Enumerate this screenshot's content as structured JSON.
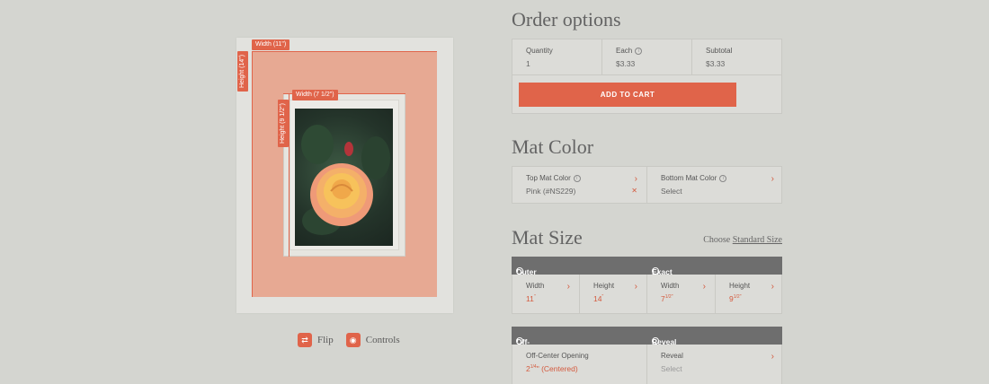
{
  "preview": {
    "outer_width_tag": "Width (11\")",
    "outer_height_tag": "Height (14\")",
    "inner_width_tag": "Width (7 1/2\")",
    "inner_height_tag": "Height (9 1/2\")",
    "photo_icon": "rose-photo",
    "flip_label": "Flip",
    "controls_label": "Controls"
  },
  "order": {
    "title": "Order options",
    "quantity_label": "Quantity",
    "quantity_value": "1",
    "each_label": "Each",
    "each_value": "$3.33",
    "subtotal_label": "Subtotal",
    "subtotal_value": "$3.33",
    "add_to_cart": "ADD TO CART"
  },
  "mat_color": {
    "title": "Mat Color",
    "top_label": "Top Mat Color",
    "top_value": "Pink (#NS229)",
    "bottom_label": "Bottom Mat Color",
    "bottom_value": "Select"
  },
  "mat_size": {
    "title": "Mat Size",
    "choose_label": "Choose",
    "choose_link": "Standard Size",
    "outer_header": "Outer size",
    "opening_header": "Exact Opening Size",
    "outer_width_label": "Width",
    "outer_width_value": "11",
    "outer_height_label": "Height",
    "outer_height_value": "14",
    "opening_width_label": "Width",
    "opening_width_whole": "7",
    "opening_width_frac": "1/2",
    "opening_height_label": "Height",
    "opening_height_whole": "9",
    "opening_height_frac": "1/2",
    "inch_mark": "\""
  },
  "offcenter": {
    "offcenter_header": "Off-Center Opening",
    "reveal_header": "Reveal",
    "offcenter_label": "Off-Center Opening",
    "offcenter_whole": "2",
    "offcenter_frac": "1/4",
    "offcenter_suffix": "\" (Centered)",
    "reveal_label": "Reveal",
    "reveal_value": "Select"
  },
  "colors": {
    "accent": "#e0644a",
    "background": "#d4d5d0",
    "dark_bar": "#6e6e6e"
  }
}
